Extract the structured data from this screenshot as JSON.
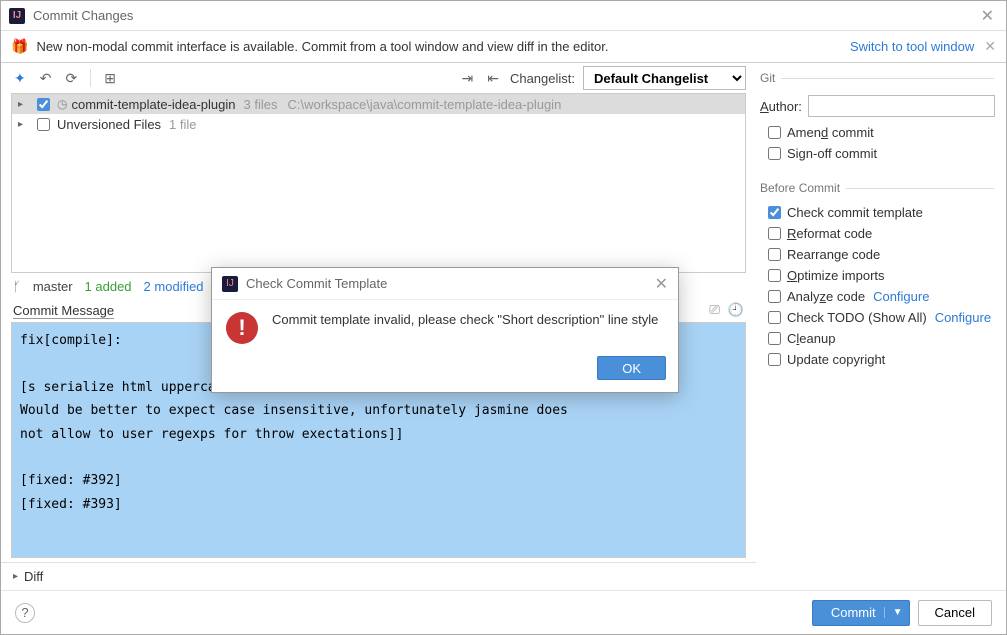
{
  "window": {
    "title": "Commit Changes"
  },
  "banner": {
    "text": "New non-modal commit interface is available. Commit from a tool window and view diff in the editor.",
    "link": "Switch to tool window"
  },
  "toolbar": {
    "changelist_label": "Changelist:",
    "changelist_value": "Default Changelist"
  },
  "tree": {
    "root": {
      "name": "commit-template-idea-plugin",
      "count": "3 files",
      "path": "C:\\workspace\\java\\commit-template-idea-plugin",
      "checked": true
    },
    "unversioned": {
      "name": "Unversioned Files",
      "count": "1 file",
      "checked": false
    }
  },
  "status": {
    "branch": "master",
    "added": "1 added",
    "modified": "2 modified"
  },
  "commit_message": {
    "label": "Commit Message",
    "value": "fix[compile]:\n\n[s serialize html uppercased, but IE9 does not...\nWould be better to expect case insensitive, unfortunately jasmine does\nnot allow to user regexps for throw exectations]]\n\n[fixed: #392]\n[fixed: #393]"
  },
  "diff": {
    "label": "Diff"
  },
  "git": {
    "section": "Git",
    "author_label": "Author:",
    "author_value": "",
    "amend": {
      "label": "Amend commit",
      "checked": false
    },
    "signoff": {
      "label": "Sign-off commit",
      "checked": false
    }
  },
  "before_commit": {
    "section": "Before Commit",
    "items": [
      {
        "key": "check_template",
        "label": "Check commit template",
        "checked": true
      },
      {
        "key": "reformat",
        "label": "Reformat code",
        "checked": false,
        "u": "R"
      },
      {
        "key": "rearrange",
        "label": "Rearrange code",
        "checked": false
      },
      {
        "key": "optimize",
        "label": "Optimize imports",
        "checked": false,
        "u": "O"
      },
      {
        "key": "analyze",
        "label": "Analyze code",
        "checked": false,
        "link": "Configure",
        "u": "A"
      },
      {
        "key": "todo",
        "label": "Check TODO (Show All)",
        "checked": false,
        "link": "Configure"
      },
      {
        "key": "cleanup",
        "label": "Cleanup",
        "checked": false,
        "u": "l"
      },
      {
        "key": "copyright",
        "label": "Update copyright",
        "checked": false
      }
    ]
  },
  "footer": {
    "commit": "Commit",
    "cancel": "Cancel"
  },
  "modal": {
    "title": "Check Commit Template",
    "message": "Commit template invalid, please check \"Short description\" line style",
    "ok": "OK"
  }
}
